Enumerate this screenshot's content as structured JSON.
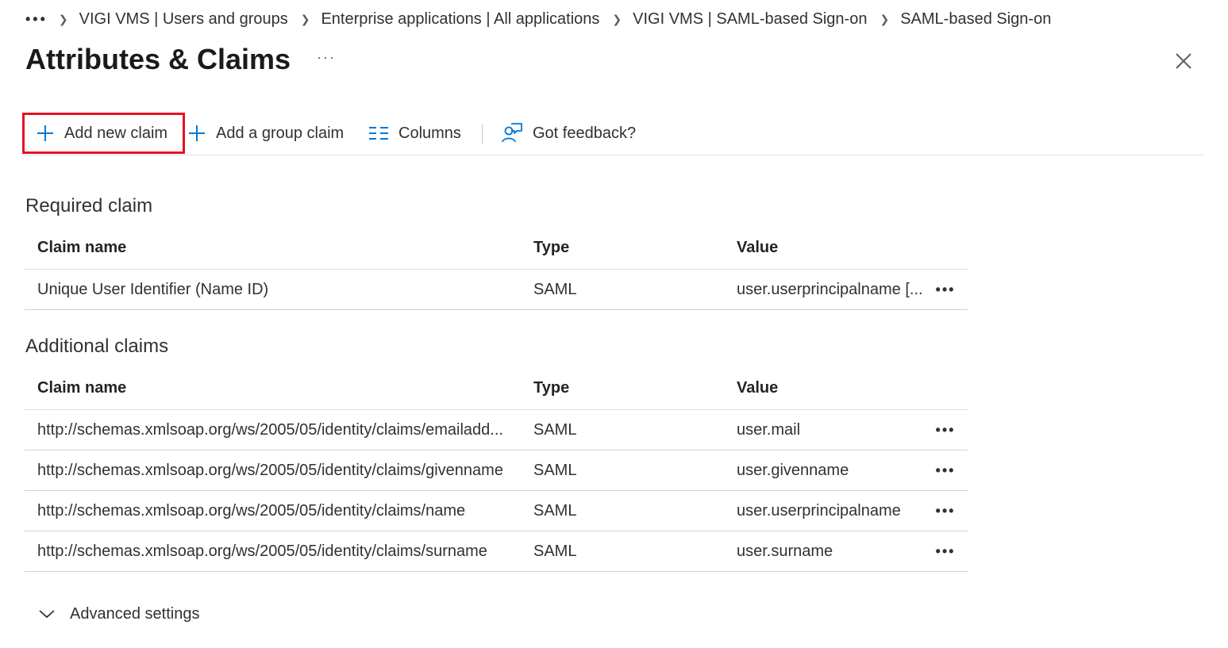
{
  "breadcrumb": {
    "more": "•••",
    "items": [
      "VIGI VMS | Users and groups",
      "Enterprise applications | All applications",
      "VIGI VMS | SAML-based Sign-on",
      "SAML-based Sign-on"
    ]
  },
  "page": {
    "title": "Attributes & Claims",
    "more": "···"
  },
  "toolbar": {
    "add_new_claim": "Add new claim",
    "add_group_claim": "Add a group claim",
    "columns": "Columns",
    "feedback": "Got feedback?"
  },
  "required": {
    "title": "Required claim",
    "headers": {
      "name": "Claim name",
      "type": "Type",
      "value": "Value"
    },
    "rows": [
      {
        "name": "Unique User Identifier (Name ID)",
        "type": "SAML",
        "value": "user.userprincipalname [...",
        "more": "•••"
      }
    ]
  },
  "additional": {
    "title": "Additional claims",
    "headers": {
      "name": "Claim name",
      "type": "Type",
      "value": "Value"
    },
    "rows": [
      {
        "name": "http://schemas.xmlsoap.org/ws/2005/05/identity/claims/emailadd...",
        "type": "SAML",
        "value": "user.mail",
        "more": "•••"
      },
      {
        "name": "http://schemas.xmlsoap.org/ws/2005/05/identity/claims/givenname",
        "type": "SAML",
        "value": "user.givenname",
        "more": "•••"
      },
      {
        "name": "http://schemas.xmlsoap.org/ws/2005/05/identity/claims/name",
        "type": "SAML",
        "value": "user.userprincipalname",
        "more": "•••"
      },
      {
        "name": "http://schemas.xmlsoap.org/ws/2005/05/identity/claims/surname",
        "type": "SAML",
        "value": "user.surname",
        "more": "•••"
      }
    ]
  },
  "advanced": {
    "label": "Advanced settings"
  },
  "colors": {
    "accent": "#0078d4",
    "highlight_border": "#e81123"
  }
}
